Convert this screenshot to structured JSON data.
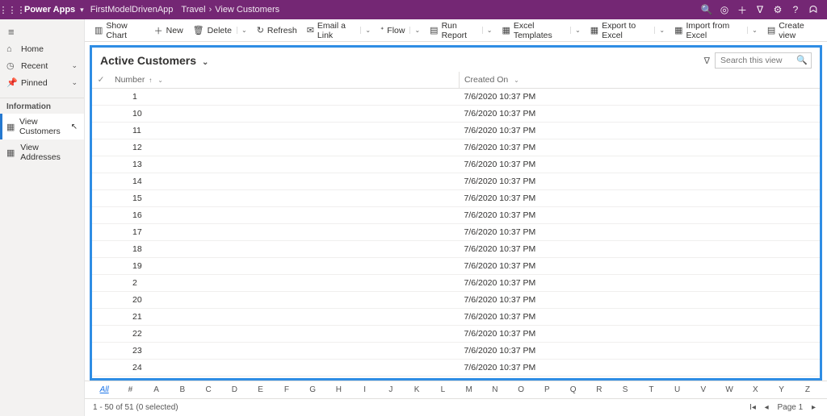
{
  "topbar": {
    "brand": "Power Apps",
    "env": "FirstModelDrivenApp",
    "crumb1": "Travel",
    "crumb2": "View Customers"
  },
  "nav": {
    "home": "Home",
    "recent": "Recent",
    "pinned": "Pinned",
    "group": "Information",
    "viewCustomers": "View Customers",
    "viewAddresses": "View Addresses"
  },
  "commands": {
    "showChart": "Show Chart",
    "new": "New",
    "delete": "Delete",
    "refresh": "Refresh",
    "emailLink": "Email a Link",
    "flow": "Flow",
    "runReport": "Run Report",
    "excelTemplates": "Excel Templates",
    "exportExcel": "Export to Excel",
    "importExcel": "Import from Excel",
    "createView": "Create view"
  },
  "view": {
    "title": "Active Customers",
    "searchPlaceholder": "Search this view"
  },
  "columns": {
    "number": "Number",
    "createdOn": "Created On"
  },
  "rows": [
    {
      "number": "1",
      "createdOn": "7/6/2020 10:37 PM"
    },
    {
      "number": "10",
      "createdOn": "7/6/2020 10:37 PM"
    },
    {
      "number": "11",
      "createdOn": "7/6/2020 10:37 PM"
    },
    {
      "number": "12",
      "createdOn": "7/6/2020 10:37 PM"
    },
    {
      "number": "13",
      "createdOn": "7/6/2020 10:37 PM"
    },
    {
      "number": "14",
      "createdOn": "7/6/2020 10:37 PM"
    },
    {
      "number": "15",
      "createdOn": "7/6/2020 10:37 PM"
    },
    {
      "number": "16",
      "createdOn": "7/6/2020 10:37 PM"
    },
    {
      "number": "17",
      "createdOn": "7/6/2020 10:37 PM"
    },
    {
      "number": "18",
      "createdOn": "7/6/2020 10:37 PM"
    },
    {
      "number": "19",
      "createdOn": "7/6/2020 10:37 PM"
    },
    {
      "number": "2",
      "createdOn": "7/6/2020 10:37 PM"
    },
    {
      "number": "20",
      "createdOn": "7/6/2020 10:37 PM"
    },
    {
      "number": "21",
      "createdOn": "7/6/2020 10:37 PM"
    },
    {
      "number": "22",
      "createdOn": "7/6/2020 10:37 PM"
    },
    {
      "number": "23",
      "createdOn": "7/6/2020 10:37 PM"
    },
    {
      "number": "24",
      "createdOn": "7/6/2020 10:37 PM"
    }
  ],
  "alpha": [
    "All",
    "#",
    "A",
    "B",
    "C",
    "D",
    "E",
    "F",
    "G",
    "H",
    "I",
    "J",
    "K",
    "L",
    "M",
    "N",
    "O",
    "P",
    "Q",
    "R",
    "S",
    "T",
    "U",
    "V",
    "W",
    "X",
    "Y",
    "Z"
  ],
  "status": {
    "range": "1 - 50 of 51 (0 selected)",
    "page": "Page 1"
  }
}
